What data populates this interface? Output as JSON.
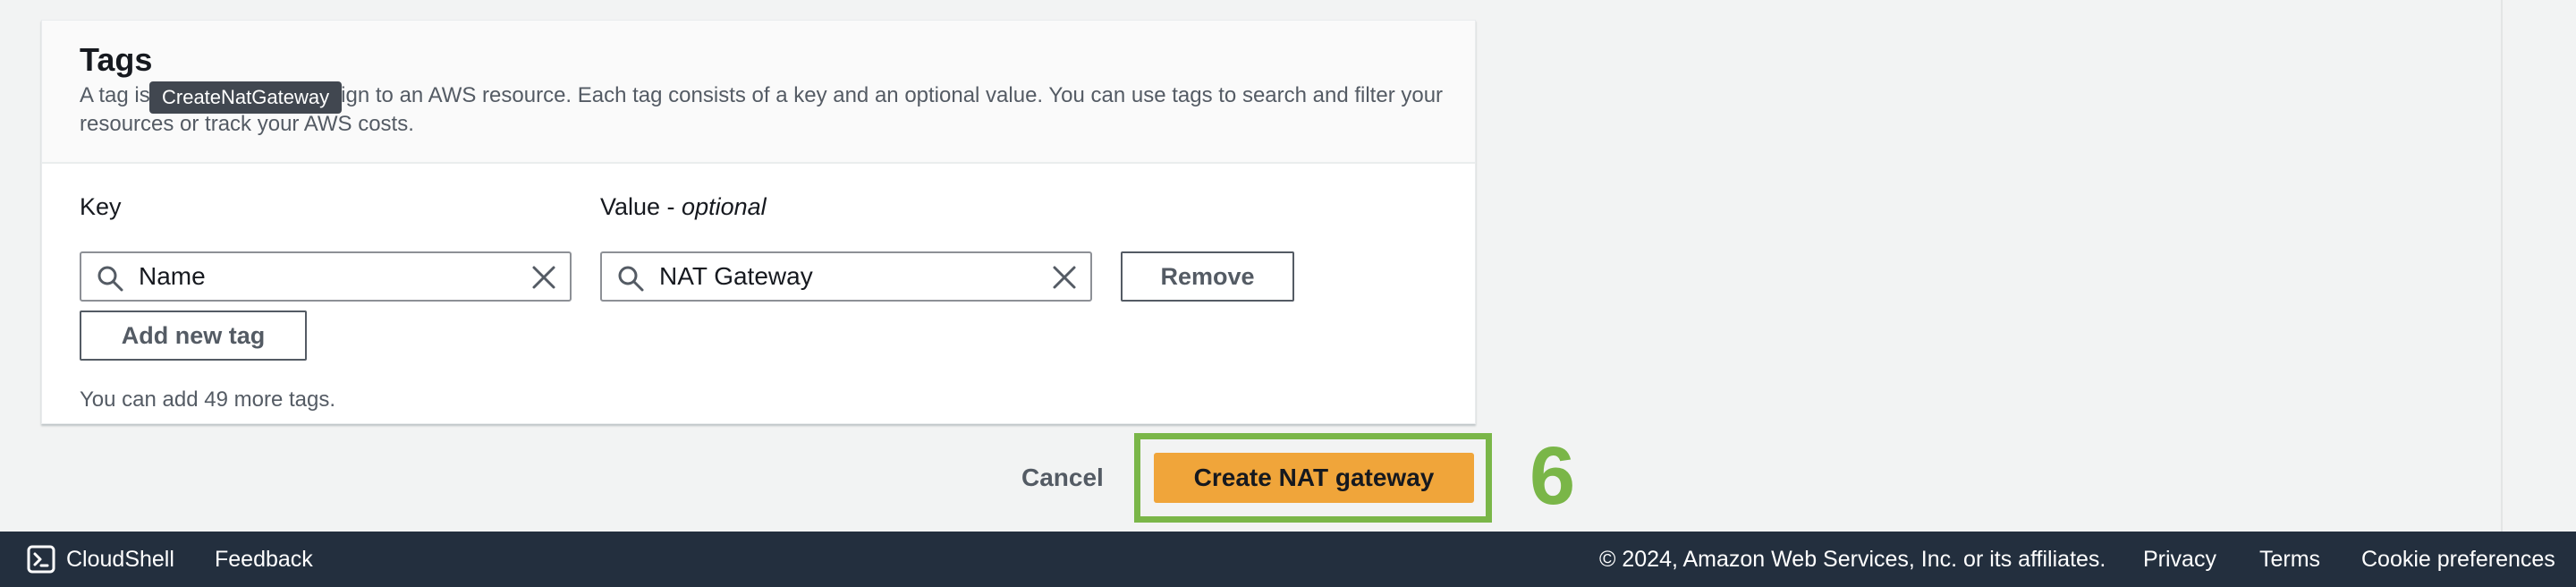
{
  "tags_panel": {
    "title": "Tags",
    "description": "A tag is a label that you assign to an AWS resource. Each tag consists of a key and an optional value. You can use tags to search and filter your resources or track your AWS costs.",
    "tooltip": "CreateNatGateway",
    "key_label": "Key",
    "value_label_prefix": "Value - ",
    "value_label_optional": "optional",
    "key_value": "Name",
    "value_value": "NAT Gateway",
    "remove_label": "Remove",
    "add_tag_label": "Add new tag",
    "hint": "You can add 49 more tags."
  },
  "actions": {
    "cancel_label": "Cancel",
    "create_label": "Create NAT gateway",
    "step_number": "6"
  },
  "footer": {
    "cloudshell": "CloudShell",
    "feedback": "Feedback",
    "copyright": "© 2024, Amazon Web Services, Inc. or its affiliates.",
    "privacy": "Privacy",
    "terms": "Terms",
    "cookie": "Cookie preferences"
  },
  "colors": {
    "primary_button": "#f0a53a",
    "highlight": "#7ab648",
    "footer_bg": "#232f3e"
  },
  "icons": [
    "search-icon",
    "clear-icon",
    "cloudshell-icon"
  ]
}
